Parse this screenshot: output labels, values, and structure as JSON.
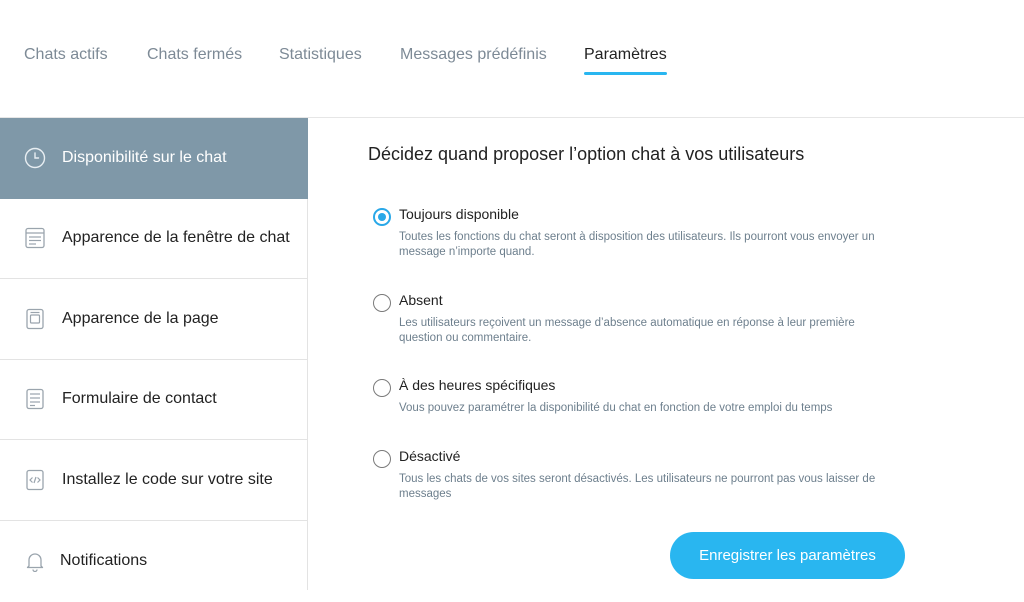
{
  "tabs": [
    {
      "label": "Chats actifs",
      "active": false
    },
    {
      "label": "Chats fermés",
      "active": false
    },
    {
      "label": "Statistiques",
      "active": false
    },
    {
      "label": "Messages prédéfinis",
      "active": false
    },
    {
      "label": "Paramètres",
      "active": true
    }
  ],
  "sidebar": {
    "items": [
      {
        "label": "Disponibilité sur le chat",
        "icon": "clock-icon",
        "active": true
      },
      {
        "label": "Apparence de la fenêtre de chat",
        "icon": "window-layout-icon",
        "active": false
      },
      {
        "label": "Apparence de la page",
        "icon": "page-icon",
        "active": false
      },
      {
        "label": "Formulaire de contact",
        "icon": "form-icon",
        "active": false
      },
      {
        "label": "Installez le code sur votre site",
        "icon": "code-icon",
        "active": false
      },
      {
        "label": "Notifications",
        "icon": "bell-icon",
        "active": false
      }
    ]
  },
  "main": {
    "heading": "Décidez quand proposer l’option chat à vos utilisateurs",
    "options": [
      {
        "title": "Toujours disponible",
        "description": "Toutes les fonctions du chat seront à disposition des utilisateurs. Ils pourront vous envoyer un message n’importe quand.",
        "checked": true
      },
      {
        "title": "Absent",
        "description": "Les utilisateurs reçoivent un message d’absence automatique en réponse à leur première question ou commentaire.",
        "checked": false
      },
      {
        "title": "À des heures spécifiques",
        "description": "Vous pouvez paramétrer la disponibilité du chat en fonction de votre emploi du temps",
        "checked": false
      },
      {
        "title": "Désactivé",
        "description": "Tous les chats de vos sites seront désactivés. Les utilisateurs ne pourront pas vous laisser de messages",
        "checked": false
      }
    ],
    "save_label": "Enregistrer les paramètres"
  },
  "colors": {
    "accent": "#29b6f0",
    "sidebar_active": "#7f98a8",
    "muted_text": "#7d8a96"
  }
}
